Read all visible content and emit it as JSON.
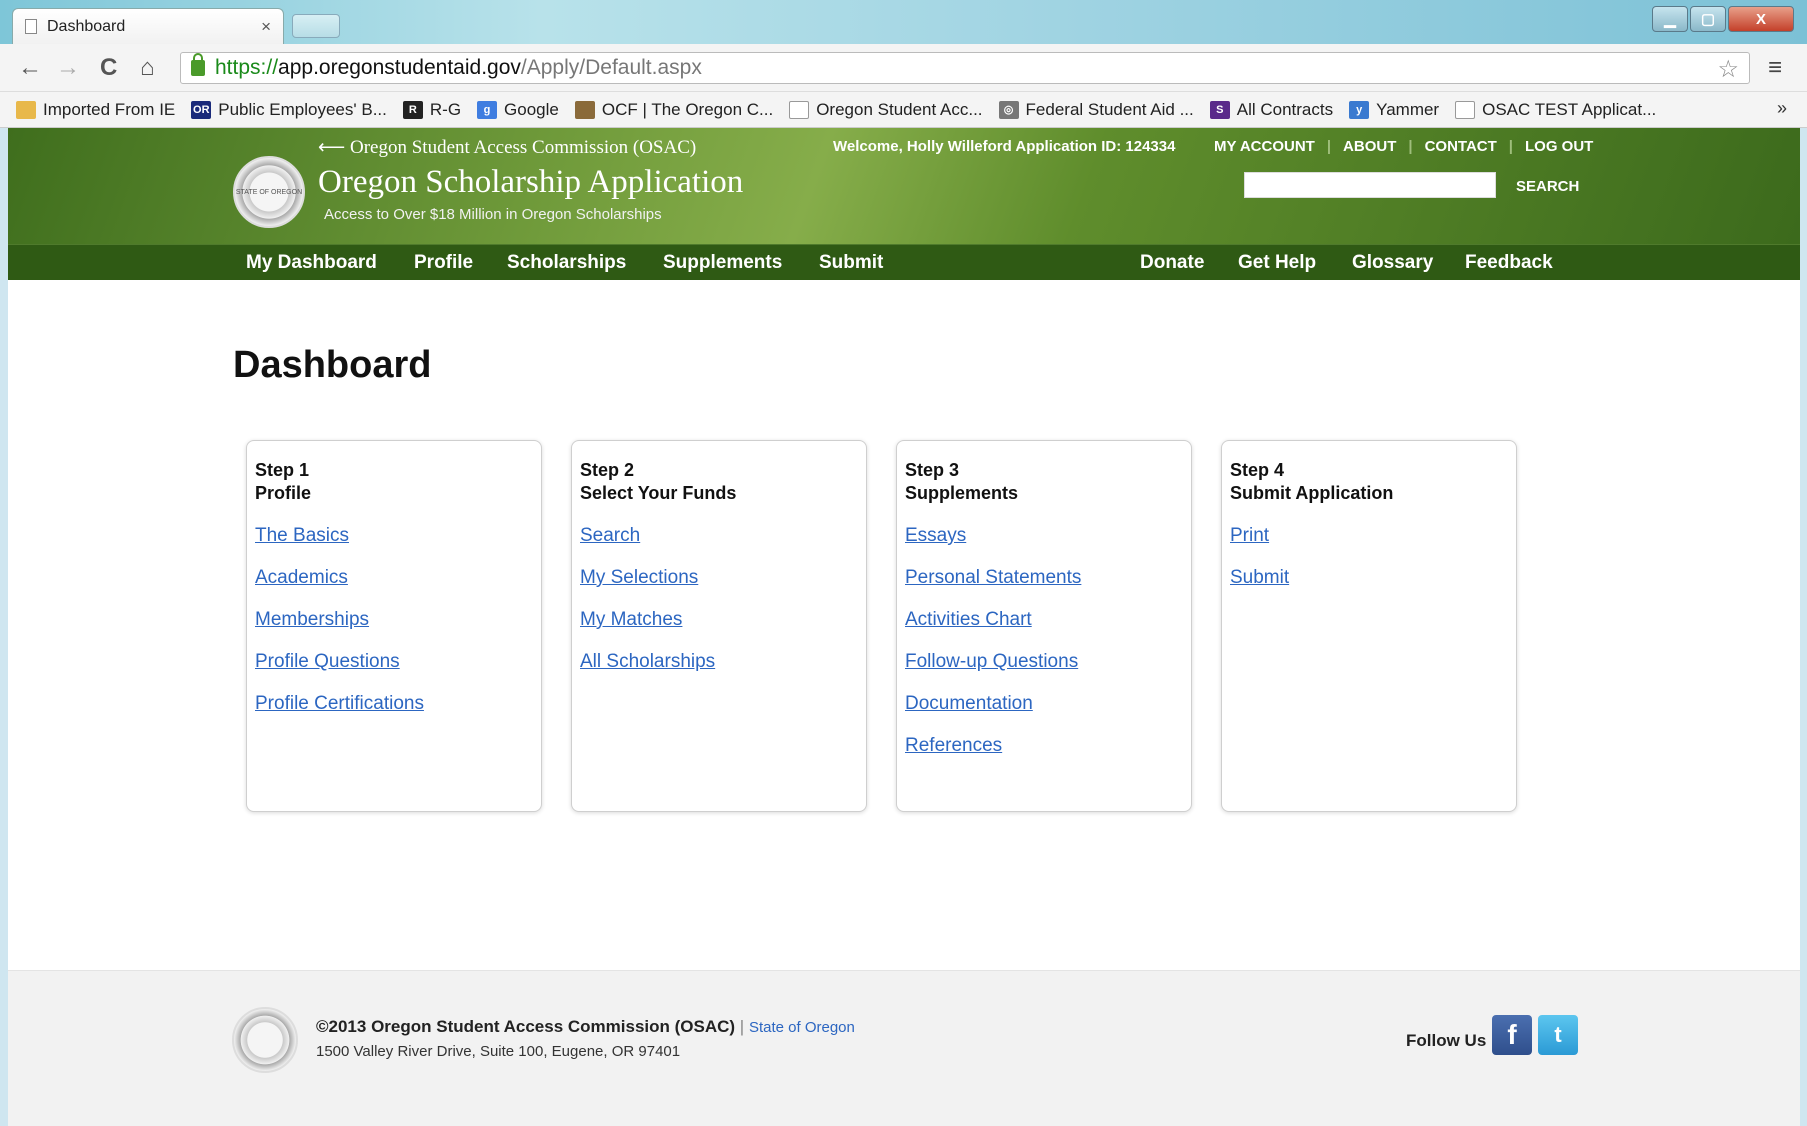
{
  "browser": {
    "tab_title": "Dashboard",
    "tab_close": "×",
    "url_scheme": "https://",
    "url_host": "app.oregonstudentaid.gov",
    "url_path": "/Apply/Default.aspx",
    "back_glyph": "←",
    "forward_glyph": "→",
    "reload_glyph": "C",
    "home_glyph": "⌂",
    "star_glyph": "☆",
    "menu_glyph": "≡",
    "min_glyph": "▁",
    "max_glyph": "▢",
    "close_glyph": "X",
    "bookmarks": [
      {
        "label": "Imported From IE",
        "icon": "folder-icon",
        "color": "#e8b84a",
        "glyph": ""
      },
      {
        "label": "Public Employees' B...",
        "icon": "or-icon",
        "color": "#1a2a7a",
        "glyph": "OR"
      },
      {
        "label": "R-G",
        "icon": "rg-icon",
        "color": "#222222",
        "glyph": "R"
      },
      {
        "label": "Google",
        "icon": "google-icon",
        "color": "#3f7de0",
        "glyph": "g"
      },
      {
        "label": "OCF | The Oregon C...",
        "icon": "ocf-icon",
        "color": "#8a6a3a",
        "glyph": ""
      },
      {
        "label": "Oregon Student Acc...",
        "icon": "page-icon",
        "color": "#ffffff",
        "glyph": ""
      },
      {
        "label": "Federal Student Aid ...",
        "icon": "fsa-icon",
        "color": "#777777",
        "glyph": "◎"
      },
      {
        "label": "All Contracts",
        "icon": "s-icon",
        "color": "#5a2a8a",
        "glyph": "S"
      },
      {
        "label": "Yammer",
        "icon": "yammer-icon",
        "color": "#3a7ad0",
        "glyph": "y"
      },
      {
        "label": "OSAC TEST Applicat...",
        "icon": "page-icon",
        "color": "#ffffff",
        "glyph": ""
      }
    ],
    "more_glyph": "»"
  },
  "header": {
    "back_link": "⟵ Oregon Student Access Commission (OSAC)",
    "title": "Oregon Scholarship Application",
    "subtitle": "Access to Over $18 Million in Oregon Scholarships",
    "welcome": "Welcome, Holly Willeford Application ID: 124334",
    "links": [
      "MY ACCOUNT",
      "ABOUT",
      "CONTACT",
      "LOG OUT"
    ],
    "search_placeholder": "",
    "search_label": "SEARCH",
    "seal_text": "STATE OF OREGON"
  },
  "nav": {
    "left": [
      "My Dashboard",
      "Profile",
      "Scholarships",
      "Supplements",
      "Submit"
    ],
    "right": [
      "Donate",
      "Get Help",
      "Glossary",
      "Feedback"
    ]
  },
  "page_title": "Dashboard",
  "steps": [
    {
      "step": "Step 1",
      "title": "Profile",
      "links": [
        "The Basics",
        "Academics",
        "Memberships",
        "Profile Questions",
        "Profile Certifications"
      ]
    },
    {
      "step": "Step 2",
      "title": "Select Your Funds",
      "links": [
        "Search",
        "My Selections",
        "My Matches",
        "All Scholarships"
      ]
    },
    {
      "step": "Step 3",
      "title": "Supplements",
      "links": [
        "Essays",
        "Personal Statements",
        "Activities Chart",
        "Follow-up Questions",
        "Documentation",
        "References"
      ]
    },
    {
      "step": "Step 4",
      "title": "Submit Application",
      "links": [
        "Print",
        "Submit"
      ]
    }
  ],
  "footer": {
    "copyright": "©2013 Oregon Student Access Commission (OSAC)",
    "separator": "|",
    "state_link": "State of Oregon",
    "address": "1500 Valley River Drive, Suite 100, Eugene, OR 97401",
    "follow_label": "Follow Us",
    "facebook_glyph": "f",
    "twitter_glyph": "t"
  },
  "colors": {
    "banner_green": "#4f7d25",
    "nav_green": "#2f5a14",
    "link_blue": "#2c66c1"
  }
}
